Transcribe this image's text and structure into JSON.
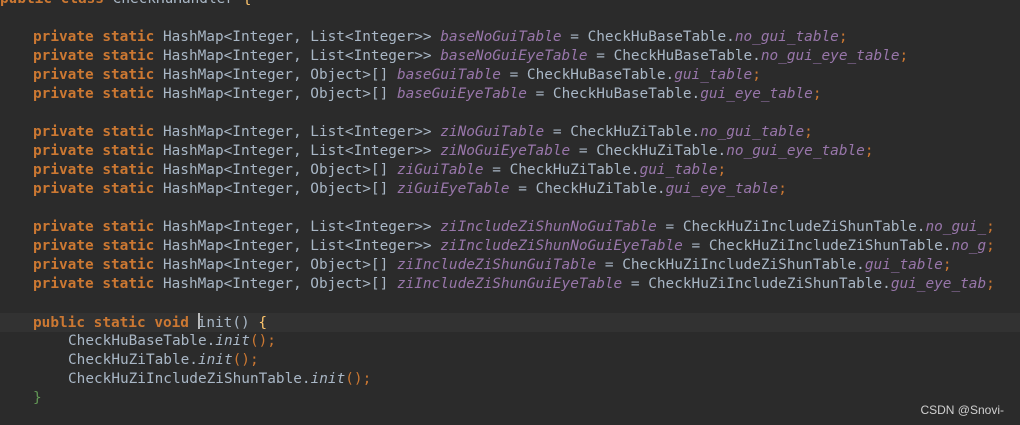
{
  "editor": {
    "header_line": {
      "k1": "public",
      "k2": "class",
      "name": "CheckHuHandler",
      "brace": "{"
    },
    "groups": [
      {
        "lines": [
          {
            "type": "List<Integer>>",
            "field": "baseNoGuiTable",
            "cls": "CheckHuBaseTable.",
            "src": "no_gui_table"
          },
          {
            "type": "List<Integer>>",
            "field": "baseNoGuiEyeTable",
            "cls": "CheckHuBaseTable.",
            "src": "no_gui_eye_table"
          },
          {
            "type": "Object>[]",
            "field": "baseGuiTable",
            "cls": "CheckHuBaseTable.",
            "src": "gui_table"
          },
          {
            "type": "Object>[]",
            "field": "baseGuiEyeTable",
            "cls": "CheckHuBaseTable.",
            "src": "gui_eye_table"
          }
        ]
      },
      {
        "lines": [
          {
            "type": "List<Integer>>",
            "field": "ziNoGuiTable",
            "cls": "CheckHuZiTable.",
            "src": "no_gui_table"
          },
          {
            "type": "List<Integer>>",
            "field": "ziNoGuiEyeTable",
            "cls": "CheckHuZiTable.",
            "src": "no_gui_eye_table"
          },
          {
            "type": "Object>[]",
            "field": "ziGuiTable",
            "cls": "CheckHuZiTable.",
            "src": "gui_table"
          },
          {
            "type": "Object>[]",
            "field": "ziGuiEyeTable",
            "cls": "CheckHuZiTable.",
            "src": "gui_eye_table"
          }
        ]
      },
      {
        "lines": [
          {
            "type": "List<Integer>>",
            "field": "ziIncludeZiShunNoGuiTable",
            "cls": "CheckHuZiIncludeZiShunTable.",
            "src": "no_gui_"
          },
          {
            "type": "List<Integer>>",
            "field": "ziIncludeZiShunNoGuiEyeTable",
            "cls": "CheckHuZiIncludeZiShunTable.",
            "src": "no_g"
          },
          {
            "type": "Object>[]",
            "field": "ziIncludeZiShunGuiTable",
            "cls": "CheckHuZiIncludeZiShunTable.",
            "src": "gui_table"
          },
          {
            "type": "Object>[]",
            "field": "ziIncludeZiShunGuiEyeTable",
            "cls": "CheckHuZiIncludeZiShunTable.",
            "src": "gui_eye_tab"
          }
        ]
      }
    ],
    "decl": {
      "k_private": "private",
      "k_static": "static",
      "map_prefix": "HashMap<Integer, ",
      "eq": "=",
      "semi": ";"
    },
    "method": {
      "k_public": "public",
      "k_static": "static",
      "k_void": "void",
      "name_first": "i",
      "name_rest": "nit",
      "parens": "()",
      "open_brace": "{",
      "calls": [
        {
          "cls": "CheckHuBaseTable.",
          "m": "init",
          "rest": "();"
        },
        {
          "cls": "CheckHuZiTable.",
          "m": "init",
          "rest": "();"
        },
        {
          "cls": "CheckHuZiIncludeZiShunTable.",
          "m": "init",
          "rest": "();"
        }
      ],
      "close_brace": "}"
    }
  },
  "watermark": "CSDN @Snovi-"
}
